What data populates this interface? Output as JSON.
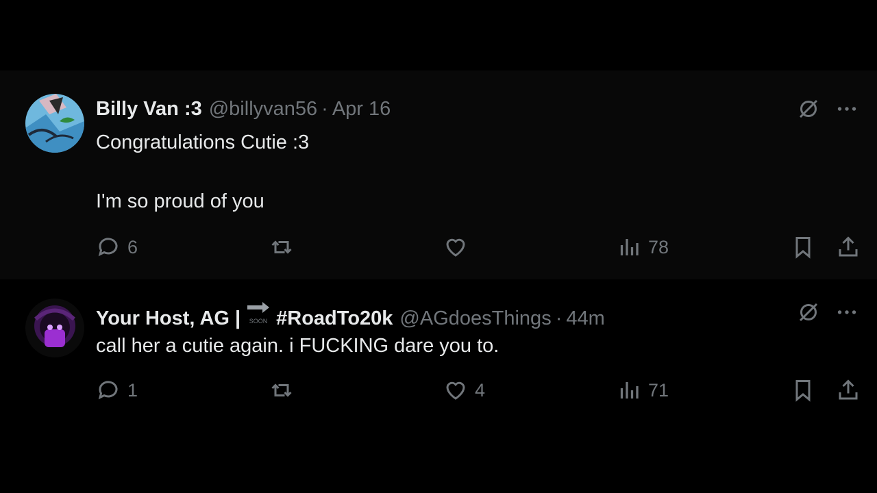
{
  "tweets": [
    {
      "author": {
        "display_name": "Billy Van :3",
        "handle": "@billyvan56",
        "separator": "·",
        "time": "Apr 16"
      },
      "body_line1": "Congratulations Cutie :3",
      "body_line2": "I'm so proud of you",
      "actions": {
        "replies": "6",
        "reposts": "",
        "likes": "",
        "views": "78"
      }
    },
    {
      "author": {
        "display_name": "Your Host, AG |",
        "badge_text": "SOON",
        "hashtag": "#RoadTo20k",
        "handle": "@AGdoesThings",
        "separator": "·",
        "time": "44m"
      },
      "body_line1": "call her a cutie again. i FUCKING dare you to.",
      "actions": {
        "replies": "1",
        "reposts": "",
        "likes": "4",
        "views": "71"
      }
    }
  ],
  "icons": {
    "reply": "reply-icon",
    "repost": "repost-icon",
    "like": "heart-icon",
    "views": "views-icon",
    "bookmark": "bookmark-icon",
    "share": "share-icon",
    "grok": "grok-icon",
    "more": "more-icon"
  },
  "colors": {
    "background": "#000000",
    "text": "#e7e9ea",
    "muted": "#71767b",
    "thread_line": "#333639"
  }
}
